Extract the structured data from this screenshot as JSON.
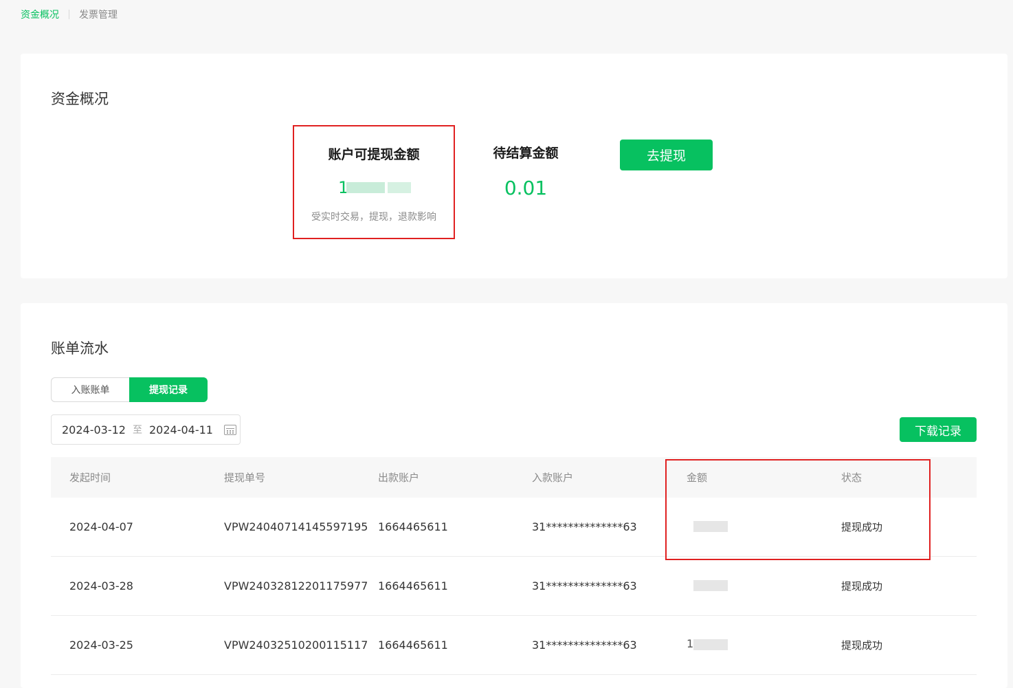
{
  "topnav": {
    "active": "资金概况",
    "other": "发票管理"
  },
  "overview": {
    "title": "资金概况",
    "withdrawable": {
      "label": "账户可提现金额",
      "value_visible": "1",
      "hint": "受实时交易，提现，退款影响"
    },
    "pending": {
      "label": "待结算金额",
      "value": "0.01"
    },
    "withdraw_button": "去提现"
  },
  "statement": {
    "title": "账单流水",
    "tabs": [
      "入账账单",
      "提现记录"
    ],
    "active_tab": "提现记录",
    "date_start": "2024-03-12",
    "date_sep": "至",
    "date_end": "2024-04-11",
    "download_button": "下载记录",
    "columns": [
      "发起时间",
      "提现单号",
      "出款账户",
      "入款账户",
      "金额",
      "状态"
    ],
    "rows": [
      {
        "date": "2024-04-07",
        "order_no": "VPW24040714145597195",
        "from": "1664465611",
        "to": "31**************63",
        "amount_visible": "",
        "status": "提现成功"
      },
      {
        "date": "2024-03-28",
        "order_no": "VPW24032812201175977",
        "from": "1664465611",
        "to": "31**************63",
        "amount_visible": "",
        "status": "提现成功"
      },
      {
        "date": "2024-03-25",
        "order_no": "VPW24032510200115117",
        "from": "1664465611",
        "to": "31**************63",
        "amount_visible": "1",
        "status": "提现成功"
      }
    ]
  },
  "colors": {
    "accent": "#07c160",
    "highlight": "#e02020"
  }
}
